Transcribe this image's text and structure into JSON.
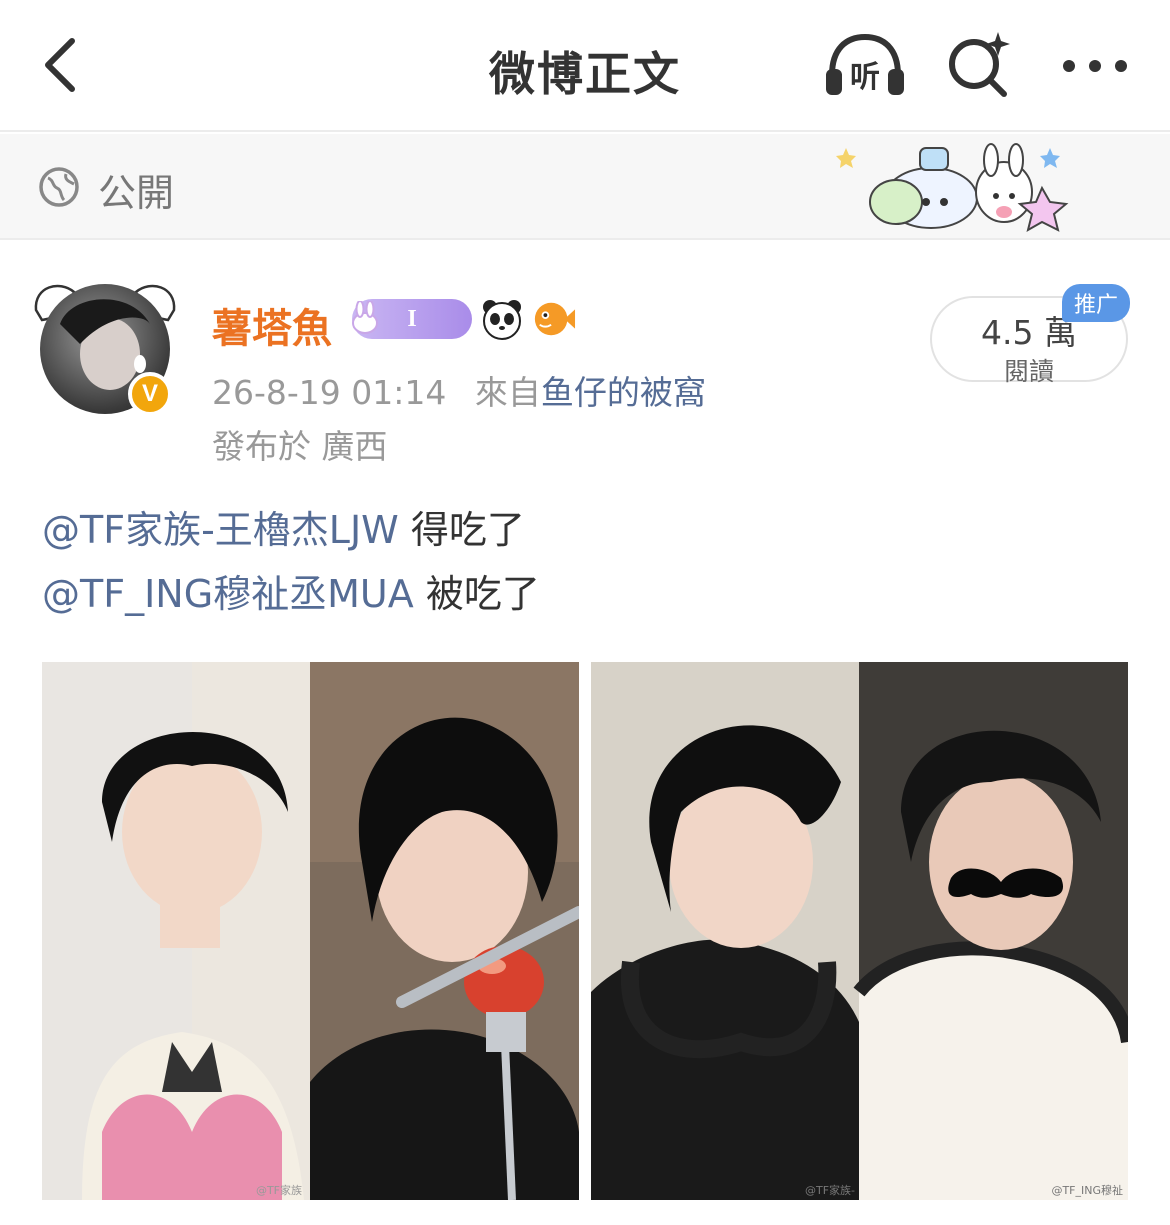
{
  "nav": {
    "title": "微博正文",
    "listen_label": "听",
    "back_icon": "chevron-left-icon",
    "search_icon": "sparkle-search-icon",
    "more_icon": "ellipsis-icon"
  },
  "visibility": {
    "label": "公開",
    "icon": "globe-icon"
  },
  "post": {
    "username": "薯塔魚",
    "badge_letter": "I",
    "timestamp": "26-8-19 01:14",
    "source_prefix": "來自",
    "source": "鱼仔的被窩",
    "location": "發布於 廣西",
    "read_count": "4.5 萬",
    "read_label": "閱讀",
    "promo_tag": "推广",
    "lines": [
      {
        "mention": "@TF家族-王櫓杰LJW",
        "text": " 得吃了"
      },
      {
        "mention": "@TF_ING穆祉丞MUA",
        "text": " 被吃了"
      }
    ],
    "images": [
      {
        "watermark_1": "@TF家族",
        "watermark_2": ""
      },
      {
        "watermark_1": "@TF家族-",
        "watermark_2": "@TF_ING穆祉"
      }
    ]
  },
  "colors": {
    "username": "#eb7222",
    "link": "#556c95",
    "verified": "#f2a60c",
    "promo": "#5a97e6"
  }
}
